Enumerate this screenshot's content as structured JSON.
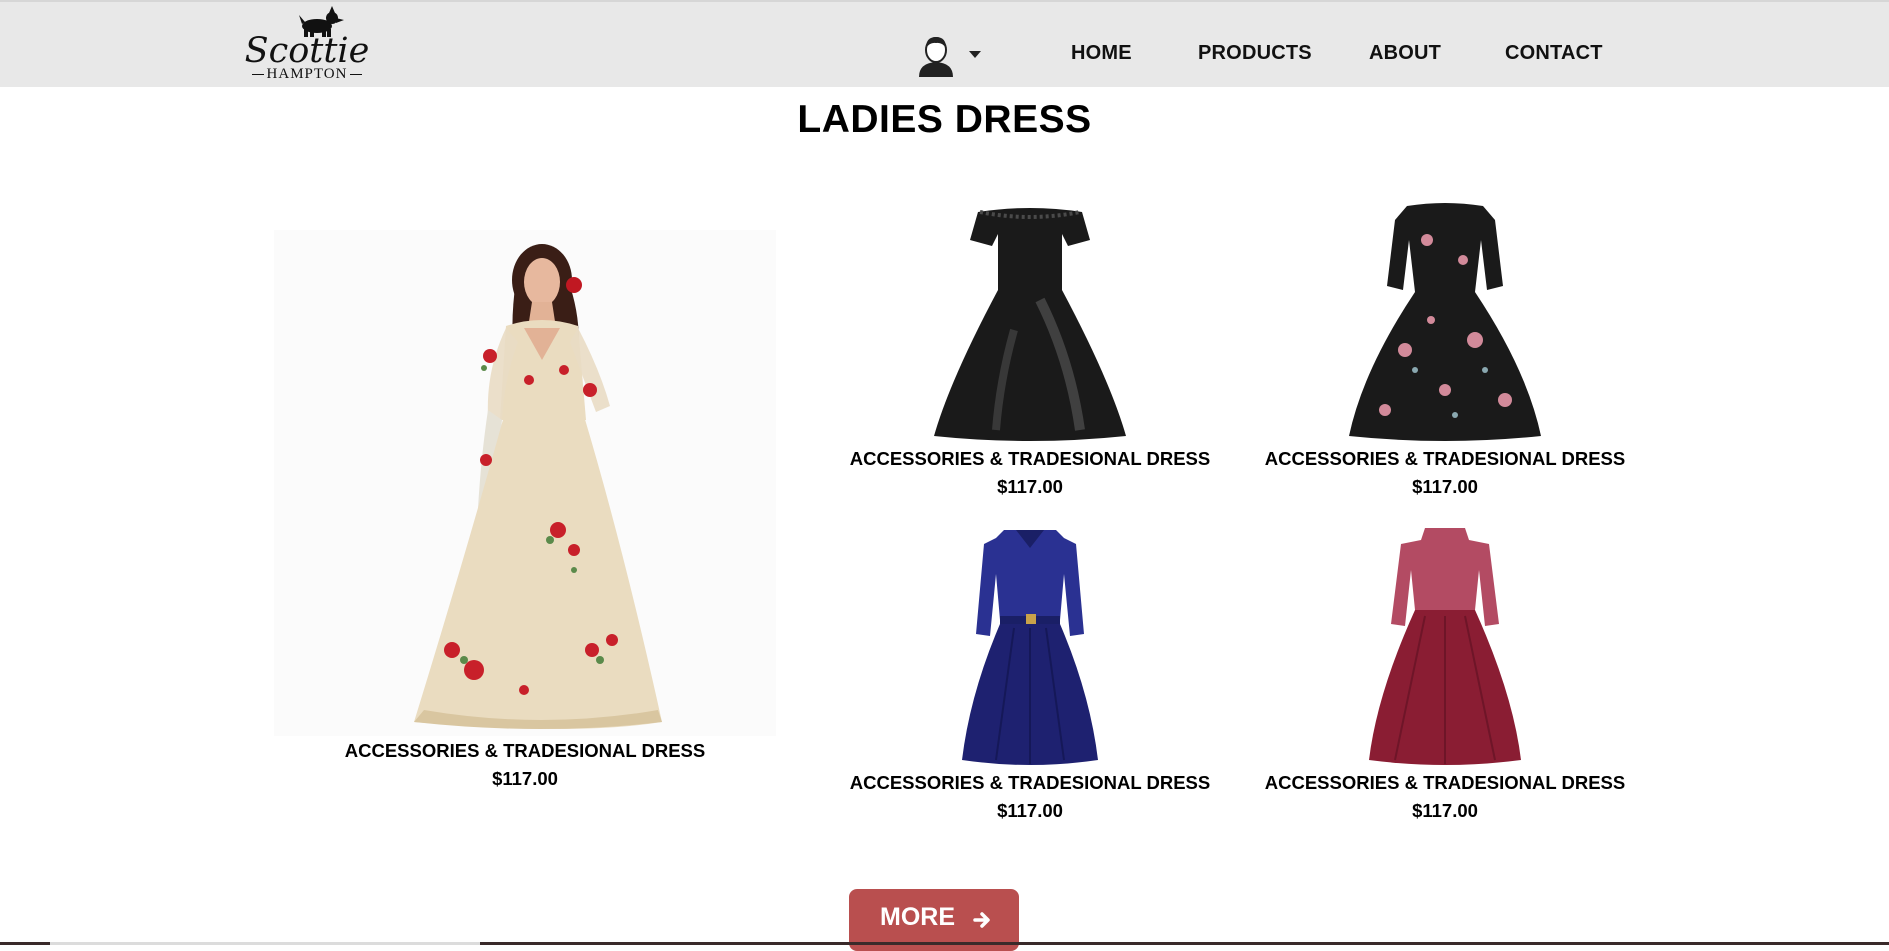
{
  "header": {
    "logo": {
      "title": "Scottie",
      "subtitle": "HAMPTON"
    },
    "account_icon": "user-avatar-icon",
    "nav": [
      {
        "label": "HOME"
      },
      {
        "label": "PRODUCTS"
      },
      {
        "label": "ABOUT"
      },
      {
        "label": "CONTACT"
      }
    ]
  },
  "main": {
    "title": "LADIES DRESS",
    "products": [
      {
        "name": "ACCESSORIES & TRADESIONAL DRESS",
        "price": "$117.00",
        "image": "cream-embroidered-gown"
      },
      {
        "name": "ACCESSORIES & TRADESIONAL DRESS",
        "price": "$117.00",
        "image": "black-lace-off-shoulder-dress"
      },
      {
        "name": "ACCESSORIES & TRADESIONAL DRESS",
        "price": "$117.00",
        "image": "black-floral-dress"
      },
      {
        "name": "ACCESSORIES & TRADESIONAL DRESS",
        "price": "$117.00",
        "image": "navy-lace-dress"
      },
      {
        "name": "ACCESSORIES & TRADESIONAL DRESS",
        "price": "$117.00",
        "image": "burgundy-lace-dress"
      }
    ],
    "more_button": {
      "label": "MORE",
      "icon": "arrow-right-icon"
    }
  },
  "colors": {
    "header_bg": "#e8e8e8",
    "button_bg": "#b94f4f",
    "dress_black": "#1a1a1a",
    "dress_navy": "#1e2170",
    "dress_burgundy": "#8a1d33",
    "gown_cream": "#eadcc0"
  }
}
